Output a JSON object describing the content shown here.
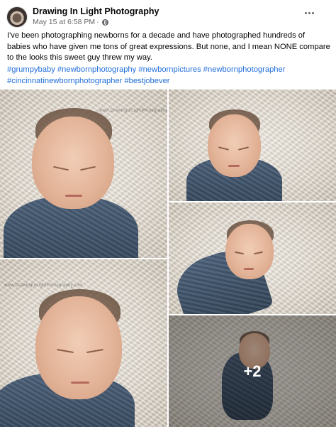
{
  "post": {
    "author": "Drawing In Light Photography",
    "timestamp": "May 15 at 6:58 PM",
    "meta_separator": "·",
    "caption": "I've been photographing newborns for a decade and have photographed hundreds of babies who have given me tons of great expressions.  But none, and I mean NONE compare to the looks this sweet guy threw my way.",
    "hashtags": [
      "#grumpybaby",
      "#newbornphotography",
      "#newbornpictures",
      "#newbornphotographer",
      "#cincinnatinewbornphotographer",
      "#bestjobever"
    ],
    "privacy_icon": "globe-icon",
    "menu_icon": "more-horizontal-icon"
  },
  "photos": {
    "watermark": "www.DrawingInLightPhotography.com",
    "more_count": "+2"
  },
  "colors": {
    "link": "#216fdb",
    "secondary_text": "#65676b",
    "wrap_blue": "#3e5168"
  }
}
